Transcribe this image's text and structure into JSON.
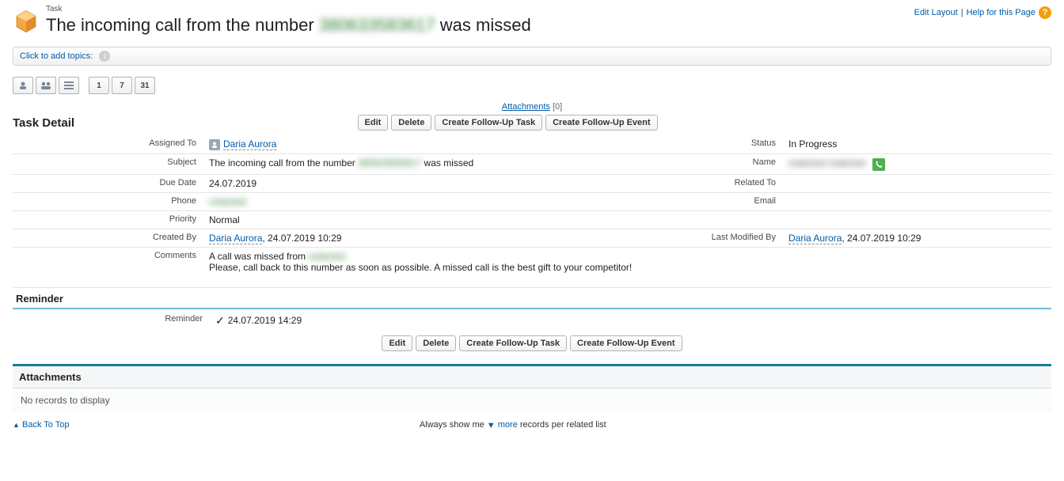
{
  "header": {
    "crumb": "Task",
    "title_prefix": "The incoming call from the number ",
    "title_secret": "380633583617",
    "title_suffix": " was missed",
    "edit_layout": "Edit Layout",
    "help": "Help for this Page"
  },
  "topics": {
    "label": "Click to add topics:"
  },
  "mini_calendar": {
    "d1": "1",
    "d7": "7",
    "d31": "31"
  },
  "attachments_link": {
    "label": "Attachments",
    "count": "[0]"
  },
  "section": {
    "title": "Task Detail",
    "buttons": {
      "edit": "Edit",
      "delete": "Delete",
      "follow_task": "Create Follow-Up Task",
      "follow_event": "Create Follow-Up Event"
    }
  },
  "fields": {
    "assigned_to_lbl": "Assigned To",
    "assigned_to_val": "Daria Aurora",
    "status_lbl": "Status",
    "status_val": "In Progress",
    "subject_lbl": "Subject",
    "subject_prefix": "The incoming call from the number ",
    "subject_secret": "380633583617",
    "subject_suffix": " was missed",
    "name_lbl": "Name",
    "name_secret": "redacted redacted",
    "due_lbl": "Due Date",
    "due_val": "24.07.2019",
    "related_lbl": "Related To",
    "related_val": "",
    "phone_lbl": "Phone",
    "phone_secret": "redacted",
    "email_lbl": "Email",
    "email_val": "",
    "priority_lbl": "Priority",
    "priority_val": "Normal",
    "created_lbl": "Created By",
    "created_user": "Daria Aurora",
    "created_ts": ", 24.07.2019 10:29",
    "modified_lbl": "Last Modified By",
    "modified_user": "Daria Aurora",
    "modified_ts": ", 24.07.2019 10:29",
    "comments_lbl": "Comments",
    "comments_l1_prefix": "A call was missed from ",
    "comments_l1_secret": "redacted",
    "comments_l2": "Please, call back to this number as soon as possible. A missed call is the best gift to your competitor!"
  },
  "reminder": {
    "header": "Reminder",
    "lbl": "Reminder",
    "val": "24.07.2019 14:29"
  },
  "attachments_block": {
    "title": "Attachments",
    "empty": "No records to display"
  },
  "footer": {
    "back": "Back To Top",
    "always_prefix": "Always show me ",
    "more": "more",
    "always_suffix": " records per related list"
  }
}
